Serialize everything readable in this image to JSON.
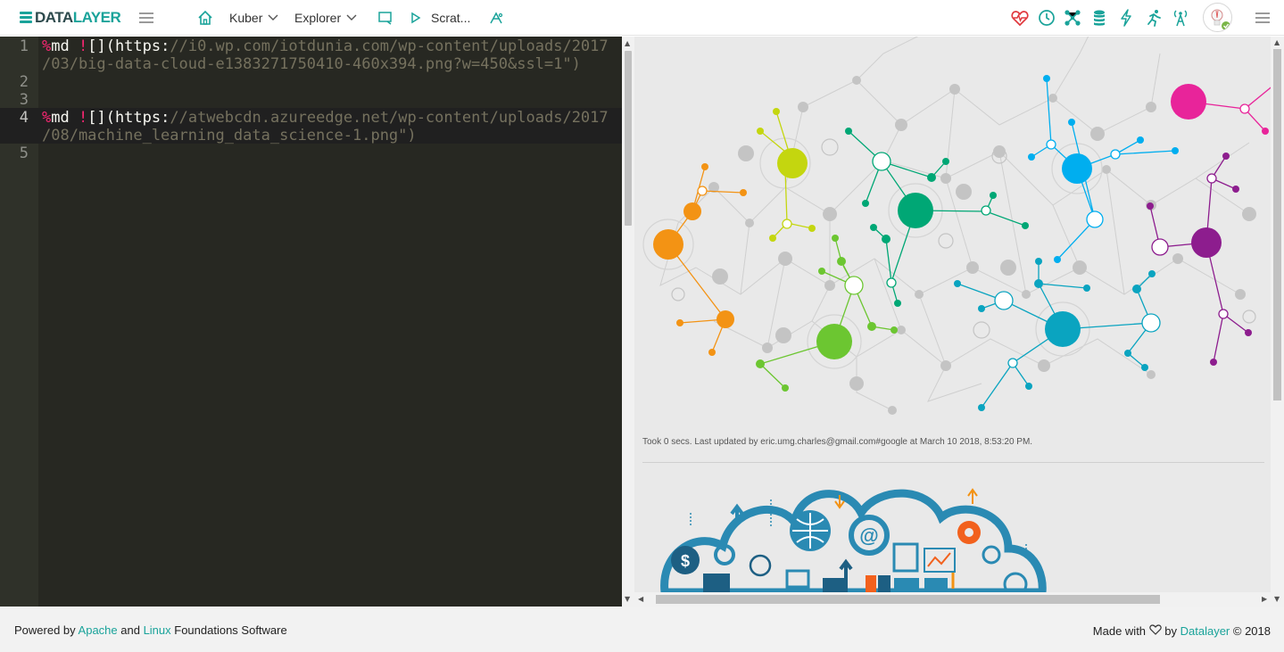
{
  "app": {
    "logo_prefix": "DATA",
    "logo_suffix": "LAYER"
  },
  "nav": {
    "items": [
      {
        "label": "Kuber"
      },
      {
        "label": "Explorer"
      },
      {
        "label": "Scrat..."
      }
    ]
  },
  "editor": {
    "line_numbers": [
      "1",
      "2",
      "3",
      "4",
      "5"
    ],
    "lines": [
      {
        "prefix": "%",
        "cmd": "md ",
        "bang": "!",
        "bracket": "[](",
        "scheme": "https:",
        "url": "//i0.wp.com/iotdunia.com/wp-content/uploads/2017",
        "url_cont": "/03/big-data-cloud-e1383271750410-460x394.png?w=450&ssl=1\")"
      },
      {
        "prefix": "%",
        "cmd": "md ",
        "bang": "!",
        "bracket": "[](",
        "scheme": "https:",
        "url": "//atwebcdn.azureedge.net/wp-content/uploads/2017",
        "url_cont": "/08/machine_learning_data_science-1.png\")"
      }
    ]
  },
  "result": {
    "status": "Took 0 secs. Last updated by eric.umg.charles@gmail.com#google at March 10 2018, 8:53:20 PM."
  },
  "footer": {
    "powered_prefix": "Powered by ",
    "apache": "Apache",
    "and": " and ",
    "linux": "Linux",
    "foundations": " Foundations Software",
    "made_with": "Made with ",
    "by": " by ",
    "datalayer": "Datalayer",
    "year": " © 2018"
  },
  "colors": {
    "brand": "#1aa39a",
    "editor_bg": "#272822",
    "pink": "#f92672",
    "url": "#75715e"
  },
  "icons": [
    "home-icon",
    "chevron-down-icon",
    "monitor-icon",
    "play-icon",
    "magic-icon",
    "heartbeat-icon",
    "clock-icon",
    "network-icon",
    "database-icon",
    "bolt-icon",
    "runner-icon",
    "tower-icon",
    "hamburger-icon"
  ]
}
